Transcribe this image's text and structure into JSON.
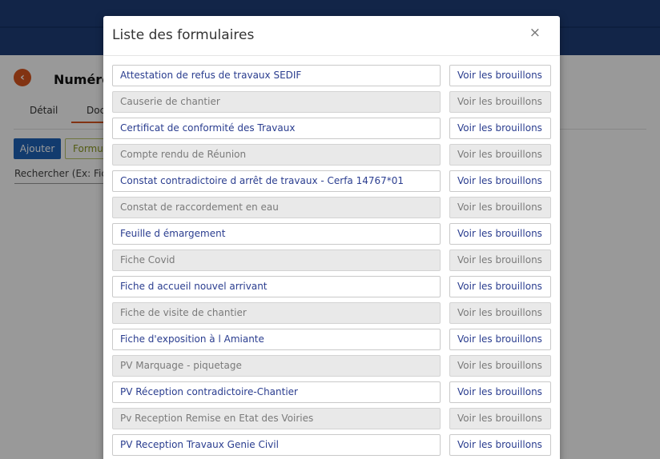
{
  "background": {
    "page_title": "Numéro",
    "tabs": {
      "details": "Détail",
      "documents": "Doc"
    },
    "buttons": {
      "add": "Ajouter",
      "forms": "Formul"
    },
    "search_placeholder": "Rechercher (Ex: Fich"
  },
  "modal": {
    "title": "Liste des formulaires",
    "close_symbol": "×",
    "drafts_label": "Voir les brouillons",
    "forms": [
      {
        "name": "Attestation de refus de travaux SEDIF",
        "enabled": true
      },
      {
        "name": "Causerie de chantier",
        "enabled": false
      },
      {
        "name": "Certificat de conformité des Travaux",
        "enabled": true
      },
      {
        "name": "Compte rendu de Réunion",
        "enabled": false
      },
      {
        "name": "Constat contradictoire d arrêt de travaux - Cerfa 14767*01",
        "enabled": true
      },
      {
        "name": "Constat de raccordement en eau",
        "enabled": false
      },
      {
        "name": "Feuille d émargement",
        "enabled": true
      },
      {
        "name": "Fiche Covid",
        "enabled": false
      },
      {
        "name": "Fiche d accueil nouvel arrivant",
        "enabled": true
      },
      {
        "name": "Fiche de visite de chantier",
        "enabled": false
      },
      {
        "name": "Fiche d'exposition à l Amiante",
        "enabled": true
      },
      {
        "name": "PV Marquage - piquetage",
        "enabled": false
      },
      {
        "name": "PV Réception contradictoire-Chantier",
        "enabled": true
      },
      {
        "name": "Pv Reception Remise en Etat des Voiries",
        "enabled": false
      },
      {
        "name": "PV Reception Travaux Genie Civil",
        "enabled": true
      }
    ]
  },
  "colors": {
    "header": "#1e3f78",
    "accent_orange": "#d9561e",
    "primary_button": "#1e63b8",
    "active_text": "#2a3d8f",
    "disabled_bg": "#e9e9e9"
  }
}
